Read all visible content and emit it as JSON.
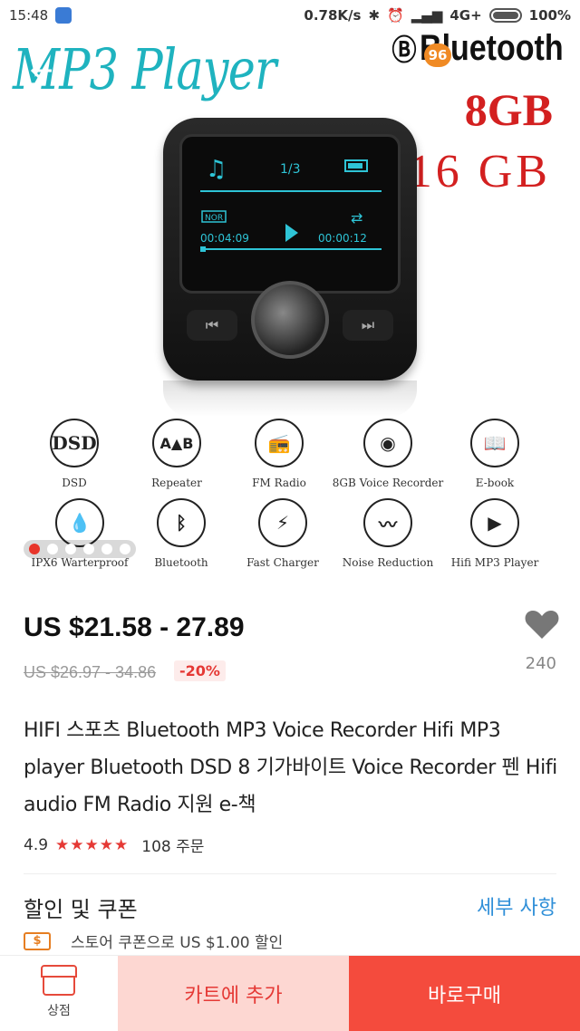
{
  "status_bar": {
    "time": "15:48",
    "network_speed": "0.78K/s",
    "signal": "4G+",
    "battery": "100%"
  },
  "image": {
    "title": "MP3 Player",
    "brand": "Bluetooth",
    "cap1": "8GB",
    "cap2": "16 GB",
    "screen_track": "1/3",
    "screen_mode": "NOR",
    "screen_elapsed": "00:04:09",
    "screen_remaining": "00:00:12",
    "features": [
      {
        "label": "DSD",
        "icon": "dsd-icon"
      },
      {
        "label": "Repeater",
        "icon": "repeater-icon"
      },
      {
        "label": "FM Radio",
        "icon": "radio-icon"
      },
      {
        "label": "8GB Voice Recorder",
        "icon": "speaker-icon"
      },
      {
        "label": "E-book",
        "icon": "book-icon"
      },
      {
        "label": "IPX6 Warterproof",
        "icon": "water-drop-icon"
      },
      {
        "label": "Bluetooth",
        "icon": "bluetooth-icon"
      },
      {
        "label": "Fast Charger",
        "icon": "lightning-icon"
      },
      {
        "label": "Noise Reduction",
        "icon": "waveform-icon"
      },
      {
        "label": "Hifi  MP3 Player",
        "icon": "play-icon"
      }
    ],
    "dsd_text": "DSD",
    "carousel_total": 6,
    "carousel_index": 1
  },
  "nav": {
    "cart_badge": "96"
  },
  "product": {
    "price": "US $21.58 - 27.89",
    "original_price": "US $26.97 - 34.86",
    "discount": "-20%",
    "wishlist_count": "240",
    "title": "HIFI 스포츠 Bluetooth MP3 Voice Recorder Hifi MP3 player Bluetooth DSD 8 기가바이트 Voice Recorder 펜 Hifi audio FM Radio 지원 e-책",
    "rating": "4.9",
    "stars": "★★★★★",
    "orders": "108 주문"
  },
  "coupon": {
    "title": "할인 및 쿠폰",
    "detail_link": "세부 사항",
    "icon_text": "$",
    "store_coupon": "스토어 쿠폰으로 US $1.00 할인"
  },
  "bottom_bar": {
    "store_label": "상점",
    "cart_label": "카트에 추가",
    "buy_label": "바로구매"
  }
}
